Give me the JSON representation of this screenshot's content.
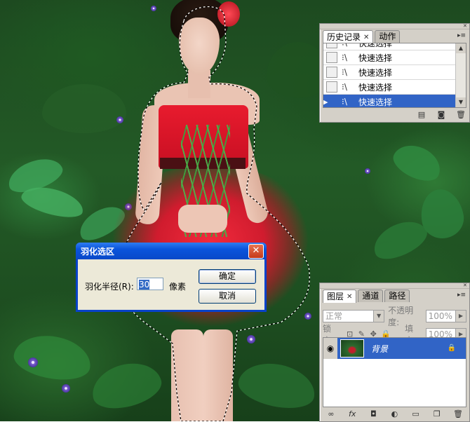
{
  "history_panel": {
    "tabs": [
      {
        "label": "历史记录",
        "active": true
      },
      {
        "label": "动作",
        "active": false
      }
    ],
    "items": [
      {
        "label": "快速选择",
        "selected": false
      },
      {
        "label": "快速选择",
        "selected": false
      },
      {
        "label": "快速选择",
        "selected": false
      },
      {
        "label": "快速选择",
        "selected": false
      },
      {
        "label": "快速选择",
        "selected": true
      }
    ]
  },
  "layers_panel": {
    "tabs": [
      {
        "label": "图层",
        "active": true
      },
      {
        "label": "通道",
        "active": false
      },
      {
        "label": "路径",
        "active": false
      }
    ],
    "blend_mode": "正常",
    "opacity_label": "不透明度:",
    "opacity_value": "100%",
    "lock_label": "锁定:",
    "fill_label": "填充:",
    "fill_value": "100%",
    "layers": [
      {
        "name": "背景",
        "selected": true,
        "visible": true,
        "locked": true
      }
    ]
  },
  "dialog": {
    "title": "羽化选区",
    "radius_label": "羽化半径(R):",
    "radius_value": "30",
    "unit": "像素",
    "ok_label": "确定",
    "cancel_label": "取消"
  },
  "colors": {
    "selection_blue": "#3164c6",
    "xp_title_blue": "#0a54dc",
    "panel_gray": "#d4d0c8"
  }
}
